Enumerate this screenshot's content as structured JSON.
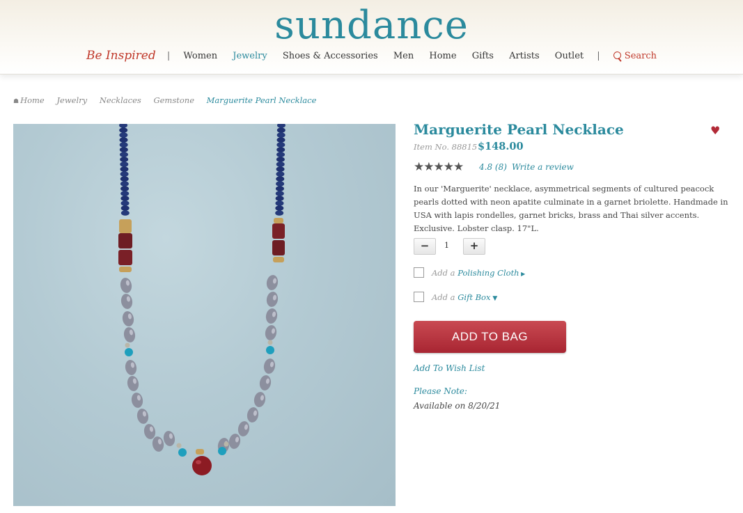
{
  "header": {
    "logo": "sundance",
    "tagline": "Be Inspired",
    "nav": [
      "Women",
      "Jewelry",
      "Shoes & Accessories",
      "Men",
      "Home",
      "Gifts",
      "Artists",
      "Outlet"
    ],
    "search_label": "Search"
  },
  "breadcrumb": [
    "Home",
    "Jewelry",
    "Necklaces",
    "Gemstone",
    "Marguerite Pearl Necklace"
  ],
  "product": {
    "title": "Marguerite Pearl Necklace",
    "item_no": "Item No. 88815",
    "price": "$148.00",
    "stars": "★★★★★",
    "rating": "4.8 (8)",
    "write_review": "Write a review",
    "description": "In our 'Marguerite' necklace, asymmetrical segments of cultured peacock pearls dotted with neon apatite culminate in a garnet briolette. Handmade in USA with lapis rondelles, garnet bricks, brass and Thai silver accents. Exclusive. Lobster clasp. 17\"L.",
    "quantity": "1",
    "minus": "−",
    "plus": "+",
    "addon_prefix": "Add a",
    "addon1": "Polishing Cloth",
    "addon2": "Gift Box",
    "add_to_bag": "ADD TO BAG",
    "wish_list": "Add To Wish List",
    "note_label": "Please Note:",
    "note_text": "Available on 8/20/21"
  },
  "colors": {
    "brand": "#2b8a9d",
    "accent_red": "#b22a37"
  }
}
